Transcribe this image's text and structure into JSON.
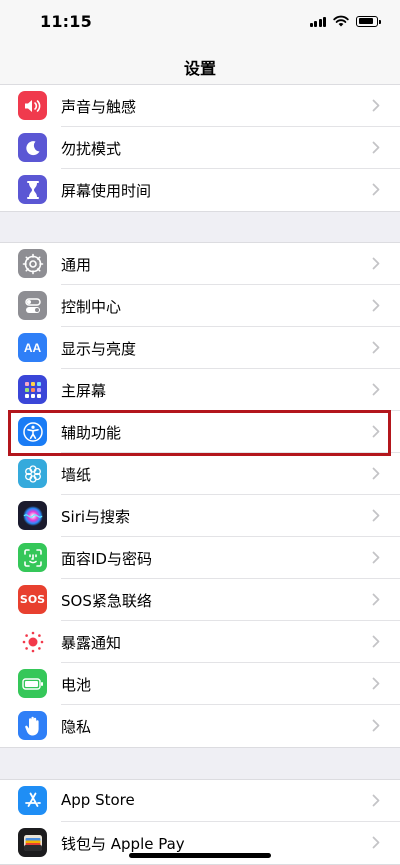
{
  "status_bar": {
    "time": "11:15"
  },
  "nav": {
    "title": "设置"
  },
  "groups": [
    {
      "items": [
        {
          "label": "声音与触感",
          "icon": "speaker-icon",
          "icon_color": "#f03a4d"
        },
        {
          "label": "勿扰模式",
          "icon": "moon-icon",
          "icon_color": "#5b57d4"
        },
        {
          "label": "屏幕使用时间",
          "icon": "hourglass-icon",
          "icon_color": "#5b57d4"
        }
      ]
    },
    {
      "items": [
        {
          "label": "通用",
          "icon": "gear-icon",
          "icon_color": "#8e8e93"
        },
        {
          "label": "控制中心",
          "icon": "toggles-icon",
          "icon_color": "#8e8e93"
        },
        {
          "label": "显示与亮度",
          "icon": "text-size-icon",
          "icon_color": "#2f7ff7",
          "icon_text": "AA"
        },
        {
          "label": "主屏幕",
          "icon": "home-grid-icon",
          "icon_color": "#3a46d8"
        },
        {
          "label": "辅助功能",
          "icon": "accessibility-icon",
          "icon_color": "#1a7cf5"
        },
        {
          "label": "墙纸",
          "icon": "flower-icon",
          "icon_color": "#35aadc"
        },
        {
          "label": "Siri与搜索",
          "icon": "siri-icon",
          "icon_color": "#1b1b2e"
        },
        {
          "label": "面容ID与密码",
          "icon": "face-id-icon",
          "icon_color": "#35c759"
        },
        {
          "label": "SOS紧急联络",
          "icon": "sos-icon",
          "icon_color": "#e8402f",
          "icon_text": "SOS"
        },
        {
          "label": "暴露通知",
          "icon": "exposure-icon",
          "icon_color": "#ffffff"
        },
        {
          "label": "电池",
          "icon": "battery-icon",
          "icon_color": "#35c759"
        },
        {
          "label": "隐私",
          "icon": "hand-icon",
          "icon_color": "#2f7ff7"
        }
      ]
    },
    {
      "items": [
        {
          "label": "App Store",
          "icon": "app-store-icon",
          "icon_color": "#1f8ef5"
        },
        {
          "label": "钱包与 Apple Pay",
          "icon": "wallet-icon",
          "icon_color": "#1c1c1e"
        }
      ]
    }
  ],
  "highlight_color": "#b3161c"
}
